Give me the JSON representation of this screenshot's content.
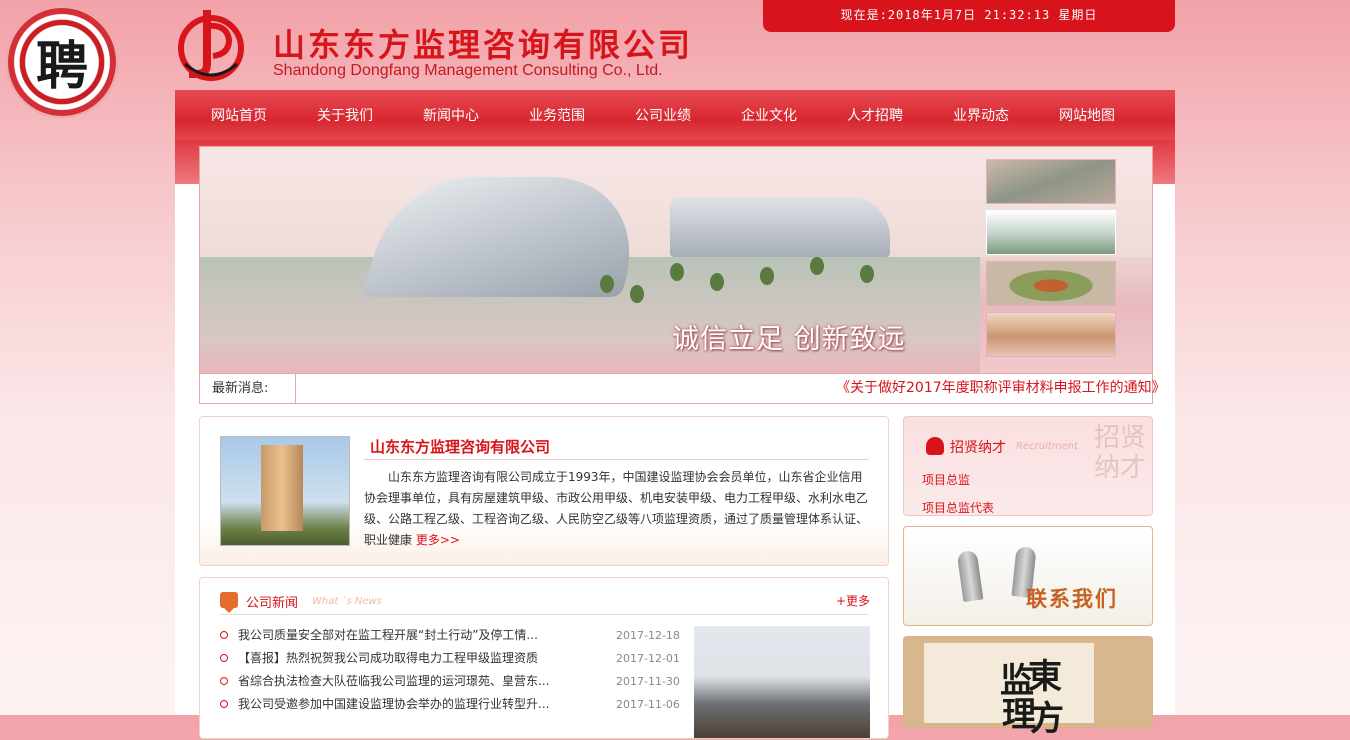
{
  "seal_char": "聘",
  "header": {
    "company_cn": "山东东方监理咨询有限公司",
    "company_en": "Shandong Dongfang Management Consulting Co., Ltd.",
    "datetime": "现在是:2018年1月7日  21:32:13  星期日"
  },
  "nav": {
    "items": [
      "网站首页",
      "关于我们",
      "新闻中心",
      "业务范围",
      "公司业绩",
      "企业文化",
      "人才招聘",
      "业界动态",
      "网站地图"
    ]
  },
  "banner": {
    "slogan": "诚信立足  创新致远"
  },
  "ticker": {
    "label": "最新消息:",
    "text": "《关于做好2017年度职称评审材料申报工作的通知》"
  },
  "about": {
    "title": "山东东方监理咨询有限公司",
    "text": "山东东方监理咨询有限公司成立于1993年，中国建设监理协会会员单位，山东省企业信用协会理事单位，具有房屋建筑甲级、市政公用甲级、机电安装甲级、电力工程甲级、水利水电乙级、公路工程乙级、工程咨询乙级、人民防空乙级等八项监理资质，通过了质量管理体系认证、职业健康",
    "more": "更多>>"
  },
  "news": {
    "title": "公司新闻",
    "subtitle": "What `s News",
    "more": "+更多",
    "items": [
      {
        "text": "我公司质量安全部对在监工程开展“封土行动”及停工情...",
        "date": "2017-12-18"
      },
      {
        "text": "【喜报】热烈祝贺我公司成功取得电力工程甲级监理资质",
        "date": "2017-12-01"
      },
      {
        "text": "省综合执法检查大队莅临我公司监理的运河璟苑、皇营东...",
        "date": "2017-11-30"
      },
      {
        "text": "我公司受邀参加中国建设监理协会举办的监理行业转型升...",
        "date": "2017-11-06"
      }
    ]
  },
  "recruit": {
    "title": "招贤纳才",
    "subtitle": "Recruitment",
    "links": [
      "项目总监",
      "项目总监代表"
    ]
  },
  "contact": {
    "label": "联系我们"
  },
  "colors": {
    "brand_red": "#d8141b",
    "nav_red": "#e03a42",
    "accent_orange": "#c8601f"
  }
}
